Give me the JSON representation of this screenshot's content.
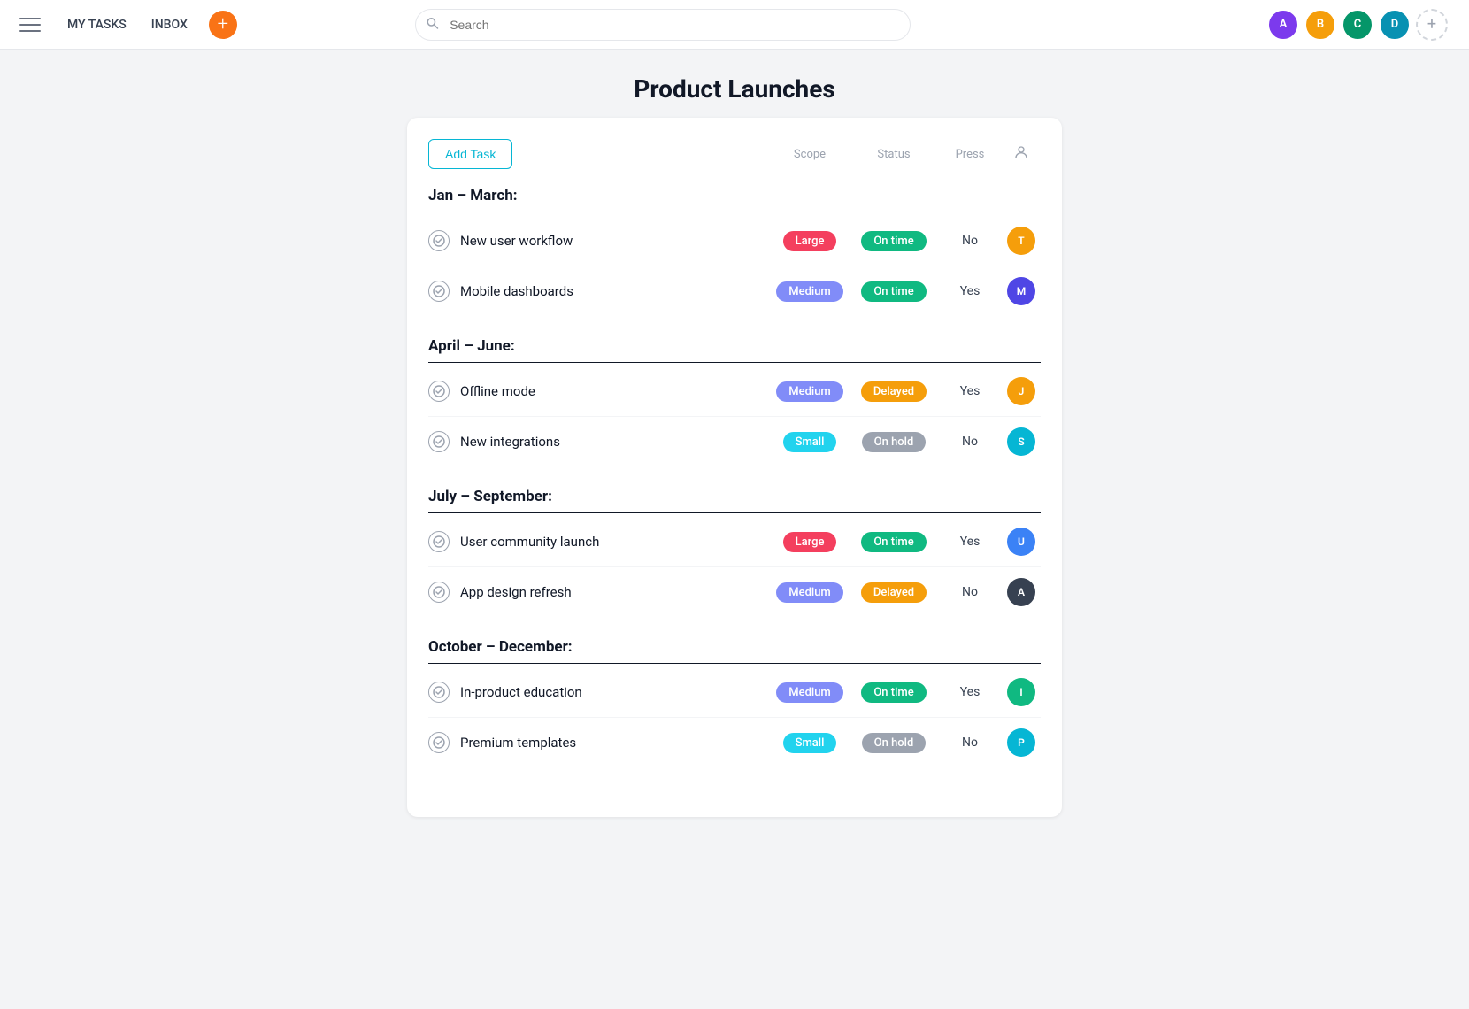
{
  "topbar": {
    "nav_items": [
      "MY TASKS",
      "INBOX"
    ],
    "add_button_label": "+",
    "search_placeholder": "Search"
  },
  "header_avatars": [
    {
      "color": "#6d28d9",
      "initials": "A",
      "bg": "#7c3aed"
    },
    {
      "color": "#f59e0b",
      "initials": "B",
      "bg": "#f59e0b"
    },
    {
      "color": "#10b981",
      "initials": "C",
      "bg": "#059669"
    },
    {
      "color": "#06b6d4",
      "initials": "D",
      "bg": "#0891b2"
    }
  ],
  "page": {
    "title": "Product Launches"
  },
  "toolbar": {
    "add_task_label": "Add Task",
    "col_scope": "Scope",
    "col_status": "Status",
    "col_press": "Press"
  },
  "sections": [
    {
      "title": "Jan – March:",
      "tasks": [
        {
          "name": "New user workflow",
          "scope": "Large",
          "scope_type": "large",
          "status": "On time",
          "status_type": "ontime",
          "press": "No",
          "avatar_color": "#f59e0b",
          "avatar_initials": "T"
        },
        {
          "name": "Mobile dashboards",
          "scope": "Medium",
          "scope_type": "medium",
          "status": "On time",
          "status_type": "ontime",
          "press": "Yes",
          "avatar_color": "#4f46e5",
          "avatar_initials": "M"
        }
      ]
    },
    {
      "title": "April – June:",
      "tasks": [
        {
          "name": "Offline mode",
          "scope": "Medium",
          "scope_type": "medium",
          "status": "Delayed",
          "status_type": "delayed",
          "press": "Yes",
          "avatar_color": "#f59e0b",
          "avatar_initials": "J"
        },
        {
          "name": "New integrations",
          "scope": "Small",
          "scope_type": "small",
          "status": "On hold",
          "status_type": "onhold",
          "press": "No",
          "avatar_color": "#06b6d4",
          "avatar_initials": "S"
        }
      ]
    },
    {
      "title": "July – September:",
      "tasks": [
        {
          "name": "User community launch",
          "scope": "Large",
          "scope_type": "large",
          "status": "On time",
          "status_type": "ontime",
          "press": "Yes",
          "avatar_color": "#3b82f6",
          "avatar_initials": "U"
        },
        {
          "name": "App design refresh",
          "scope": "Medium",
          "scope_type": "medium",
          "status": "Delayed",
          "status_type": "delayed",
          "press": "No",
          "avatar_color": "#374151",
          "avatar_initials": "A"
        }
      ]
    },
    {
      "title": "October – December:",
      "tasks": [
        {
          "name": "In-product education",
          "scope": "Medium",
          "scope_type": "medium",
          "status": "On time",
          "status_type": "ontime",
          "press": "Yes",
          "avatar_color": "#10b981",
          "avatar_initials": "I"
        },
        {
          "name": "Premium templates",
          "scope": "Small",
          "scope_type": "small",
          "status": "On hold",
          "status_type": "onhold",
          "press": "No",
          "avatar_color": "#06b6d4",
          "avatar_initials": "P"
        }
      ]
    }
  ]
}
